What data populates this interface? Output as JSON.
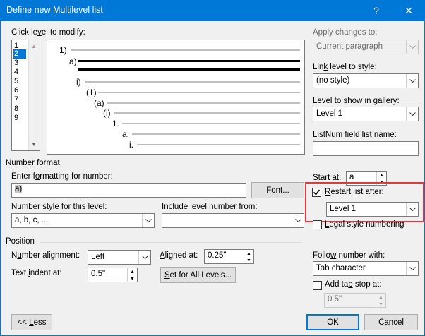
{
  "window": {
    "title": "Define new Multilevel list",
    "help_label": "?",
    "close_label": "✕"
  },
  "levels": {
    "label": "Click level to modify:",
    "items": [
      "1",
      "2",
      "3",
      "4",
      "5",
      "6",
      "7",
      "8",
      "9"
    ],
    "selected_index": 1
  },
  "preview": {
    "labels": [
      "1)",
      "a)",
      "i)",
      "(1)",
      "(a)",
      "(i)",
      "1.",
      "a.",
      "i."
    ]
  },
  "apply_changes": {
    "label": "Apply changes to:",
    "value": "Current paragraph"
  },
  "link_level": {
    "label": "Link level to style:",
    "value": "(no style)"
  },
  "level_gallery": {
    "label": "Level to show in gallery:",
    "value": "Level 1"
  },
  "listnum": {
    "label": "ListNum field list name:",
    "value": ""
  },
  "number_format": {
    "section_label": "Number format",
    "enter_label": "Enter formatting for number:",
    "format_value": "a)",
    "font_button": "Font...",
    "style_label": "Number style for this level:",
    "style_value": "a, b, c, ...",
    "include_label": "Include level number from:",
    "include_value": "",
    "start_at_label": "Start at:",
    "start_at_value": "a",
    "restart_label": "Restart list after:",
    "restart_checked": true,
    "restart_value": "Level 1",
    "legal_label": "Legal style numbering",
    "legal_checked": false
  },
  "position": {
    "section_label": "Position",
    "alignment_label": "Number alignment:",
    "alignment_value": "Left",
    "aligned_at_label": "Aligned at:",
    "aligned_at_value": "0.25\"",
    "indent_label": "Text indent at:",
    "indent_value": "0.5\"",
    "set_all_button": "Set for All Levels...",
    "follow_label": "Follow number with:",
    "follow_value": "Tab character",
    "add_tab_label": "Add tab stop at:",
    "add_tab_checked": false,
    "tab_stop_value": "0.5\""
  },
  "buttons": {
    "less": "<< Less",
    "ok": "OK",
    "cancel": "Cancel"
  }
}
